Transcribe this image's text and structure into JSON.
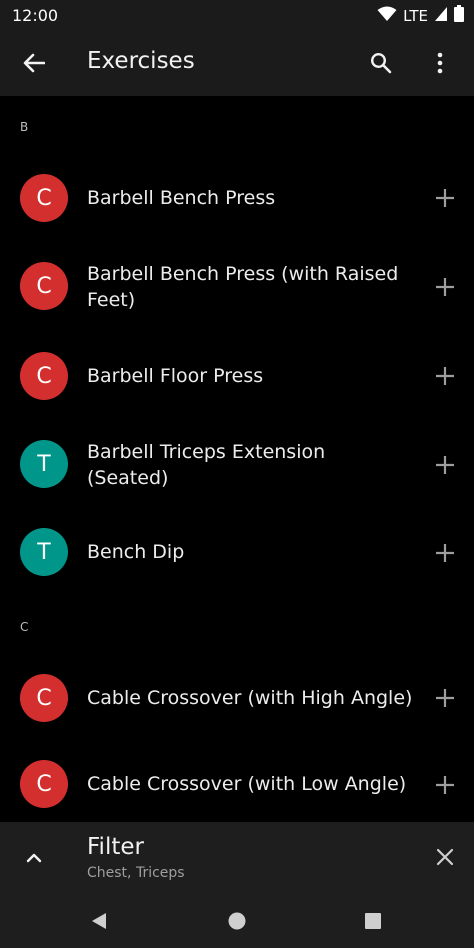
{
  "status_bar": {
    "time": "12:00",
    "network": "LTE"
  },
  "app_bar": {
    "title": "Exercises"
  },
  "list": {
    "sections": [
      {
        "header": "B",
        "items": [
          {
            "avatar": "C",
            "color": "#d32f2f",
            "label": "Barbell Bench Press"
          },
          {
            "avatar": "C",
            "color": "#d32f2f",
            "label": "Barbell Bench Press (with Raised Feet)"
          },
          {
            "avatar": "C",
            "color": "#d32f2f",
            "label": "Barbell Floor Press"
          },
          {
            "avatar": "T",
            "color": "#00968a",
            "label": "Barbell Triceps Extension (Seated)"
          },
          {
            "avatar": "T",
            "color": "#00968a",
            "label": "Bench Dip"
          }
        ]
      },
      {
        "header": "C",
        "items": [
          {
            "avatar": "C",
            "color": "#d32f2f",
            "label": "Cable Crossover (with High Angle)"
          },
          {
            "avatar": "C",
            "color": "#d32f2f",
            "label": "Cable Crossover (with Low Angle)"
          }
        ]
      }
    ]
  },
  "filter": {
    "title": "Filter",
    "subtitle": "Chest, Triceps"
  },
  "icons": {
    "back": "arrow-back-icon",
    "search": "search-icon",
    "more": "more-vert-icon",
    "add": "plus-icon",
    "expand": "chevron-up-icon",
    "close": "close-icon",
    "nav_back": "triangle-back-icon",
    "nav_home": "circle-home-icon",
    "nav_recents": "square-recents-icon"
  }
}
